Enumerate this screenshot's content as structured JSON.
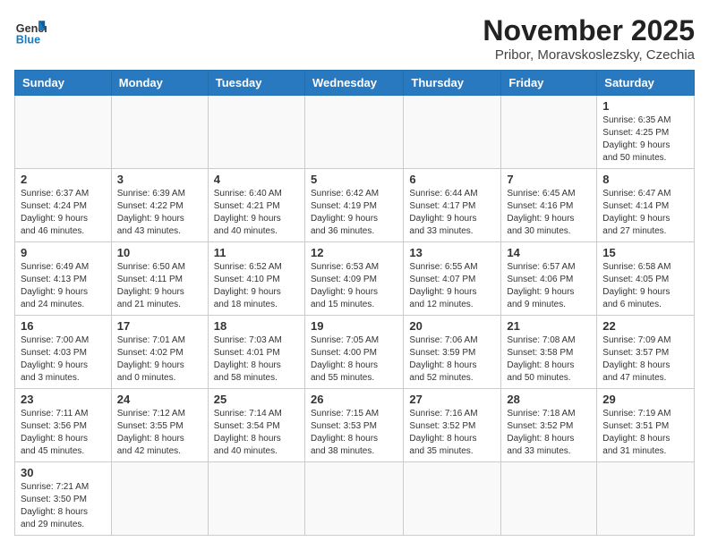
{
  "logo": {
    "general": "General",
    "blue": "Blue"
  },
  "header": {
    "month": "November 2025",
    "location": "Pribor, Moravskoslezsky, Czechia"
  },
  "days_of_week": [
    "Sunday",
    "Monday",
    "Tuesday",
    "Wednesday",
    "Thursday",
    "Friday",
    "Saturday"
  ],
  "weeks": [
    [
      {
        "day": "",
        "info": ""
      },
      {
        "day": "",
        "info": ""
      },
      {
        "day": "",
        "info": ""
      },
      {
        "day": "",
        "info": ""
      },
      {
        "day": "",
        "info": ""
      },
      {
        "day": "",
        "info": ""
      },
      {
        "day": "1",
        "info": "Sunrise: 6:35 AM\nSunset: 4:25 PM\nDaylight: 9 hours\nand 50 minutes."
      }
    ],
    [
      {
        "day": "2",
        "info": "Sunrise: 6:37 AM\nSunset: 4:24 PM\nDaylight: 9 hours\nand 46 minutes."
      },
      {
        "day": "3",
        "info": "Sunrise: 6:39 AM\nSunset: 4:22 PM\nDaylight: 9 hours\nand 43 minutes."
      },
      {
        "day": "4",
        "info": "Sunrise: 6:40 AM\nSunset: 4:21 PM\nDaylight: 9 hours\nand 40 minutes."
      },
      {
        "day": "5",
        "info": "Sunrise: 6:42 AM\nSunset: 4:19 PM\nDaylight: 9 hours\nand 36 minutes."
      },
      {
        "day": "6",
        "info": "Sunrise: 6:44 AM\nSunset: 4:17 PM\nDaylight: 9 hours\nand 33 minutes."
      },
      {
        "day": "7",
        "info": "Sunrise: 6:45 AM\nSunset: 4:16 PM\nDaylight: 9 hours\nand 30 minutes."
      },
      {
        "day": "8",
        "info": "Sunrise: 6:47 AM\nSunset: 4:14 PM\nDaylight: 9 hours\nand 27 minutes."
      }
    ],
    [
      {
        "day": "9",
        "info": "Sunrise: 6:49 AM\nSunset: 4:13 PM\nDaylight: 9 hours\nand 24 minutes."
      },
      {
        "day": "10",
        "info": "Sunrise: 6:50 AM\nSunset: 4:11 PM\nDaylight: 9 hours\nand 21 minutes."
      },
      {
        "day": "11",
        "info": "Sunrise: 6:52 AM\nSunset: 4:10 PM\nDaylight: 9 hours\nand 18 minutes."
      },
      {
        "day": "12",
        "info": "Sunrise: 6:53 AM\nSunset: 4:09 PM\nDaylight: 9 hours\nand 15 minutes."
      },
      {
        "day": "13",
        "info": "Sunrise: 6:55 AM\nSunset: 4:07 PM\nDaylight: 9 hours\nand 12 minutes."
      },
      {
        "day": "14",
        "info": "Sunrise: 6:57 AM\nSunset: 4:06 PM\nDaylight: 9 hours\nand 9 minutes."
      },
      {
        "day": "15",
        "info": "Sunrise: 6:58 AM\nSunset: 4:05 PM\nDaylight: 9 hours\nand 6 minutes."
      }
    ],
    [
      {
        "day": "16",
        "info": "Sunrise: 7:00 AM\nSunset: 4:03 PM\nDaylight: 9 hours\nand 3 minutes."
      },
      {
        "day": "17",
        "info": "Sunrise: 7:01 AM\nSunset: 4:02 PM\nDaylight: 9 hours\nand 0 minutes."
      },
      {
        "day": "18",
        "info": "Sunrise: 7:03 AM\nSunset: 4:01 PM\nDaylight: 8 hours\nand 58 minutes."
      },
      {
        "day": "19",
        "info": "Sunrise: 7:05 AM\nSunset: 4:00 PM\nDaylight: 8 hours\nand 55 minutes."
      },
      {
        "day": "20",
        "info": "Sunrise: 7:06 AM\nSunset: 3:59 PM\nDaylight: 8 hours\nand 52 minutes."
      },
      {
        "day": "21",
        "info": "Sunrise: 7:08 AM\nSunset: 3:58 PM\nDaylight: 8 hours\nand 50 minutes."
      },
      {
        "day": "22",
        "info": "Sunrise: 7:09 AM\nSunset: 3:57 PM\nDaylight: 8 hours\nand 47 minutes."
      }
    ],
    [
      {
        "day": "23",
        "info": "Sunrise: 7:11 AM\nSunset: 3:56 PM\nDaylight: 8 hours\nand 45 minutes."
      },
      {
        "day": "24",
        "info": "Sunrise: 7:12 AM\nSunset: 3:55 PM\nDaylight: 8 hours\nand 42 minutes."
      },
      {
        "day": "25",
        "info": "Sunrise: 7:14 AM\nSunset: 3:54 PM\nDaylight: 8 hours\nand 40 minutes."
      },
      {
        "day": "26",
        "info": "Sunrise: 7:15 AM\nSunset: 3:53 PM\nDaylight: 8 hours\nand 38 minutes."
      },
      {
        "day": "27",
        "info": "Sunrise: 7:16 AM\nSunset: 3:52 PM\nDaylight: 8 hours\nand 35 minutes."
      },
      {
        "day": "28",
        "info": "Sunrise: 7:18 AM\nSunset: 3:52 PM\nDaylight: 8 hours\nand 33 minutes."
      },
      {
        "day": "29",
        "info": "Sunrise: 7:19 AM\nSunset: 3:51 PM\nDaylight: 8 hours\nand 31 minutes."
      }
    ],
    [
      {
        "day": "30",
        "info": "Sunrise: 7:21 AM\nSunset: 3:50 PM\nDaylight: 8 hours\nand 29 minutes."
      },
      {
        "day": "",
        "info": ""
      },
      {
        "day": "",
        "info": ""
      },
      {
        "day": "",
        "info": ""
      },
      {
        "day": "",
        "info": ""
      },
      {
        "day": "",
        "info": ""
      },
      {
        "day": "",
        "info": ""
      }
    ]
  ]
}
